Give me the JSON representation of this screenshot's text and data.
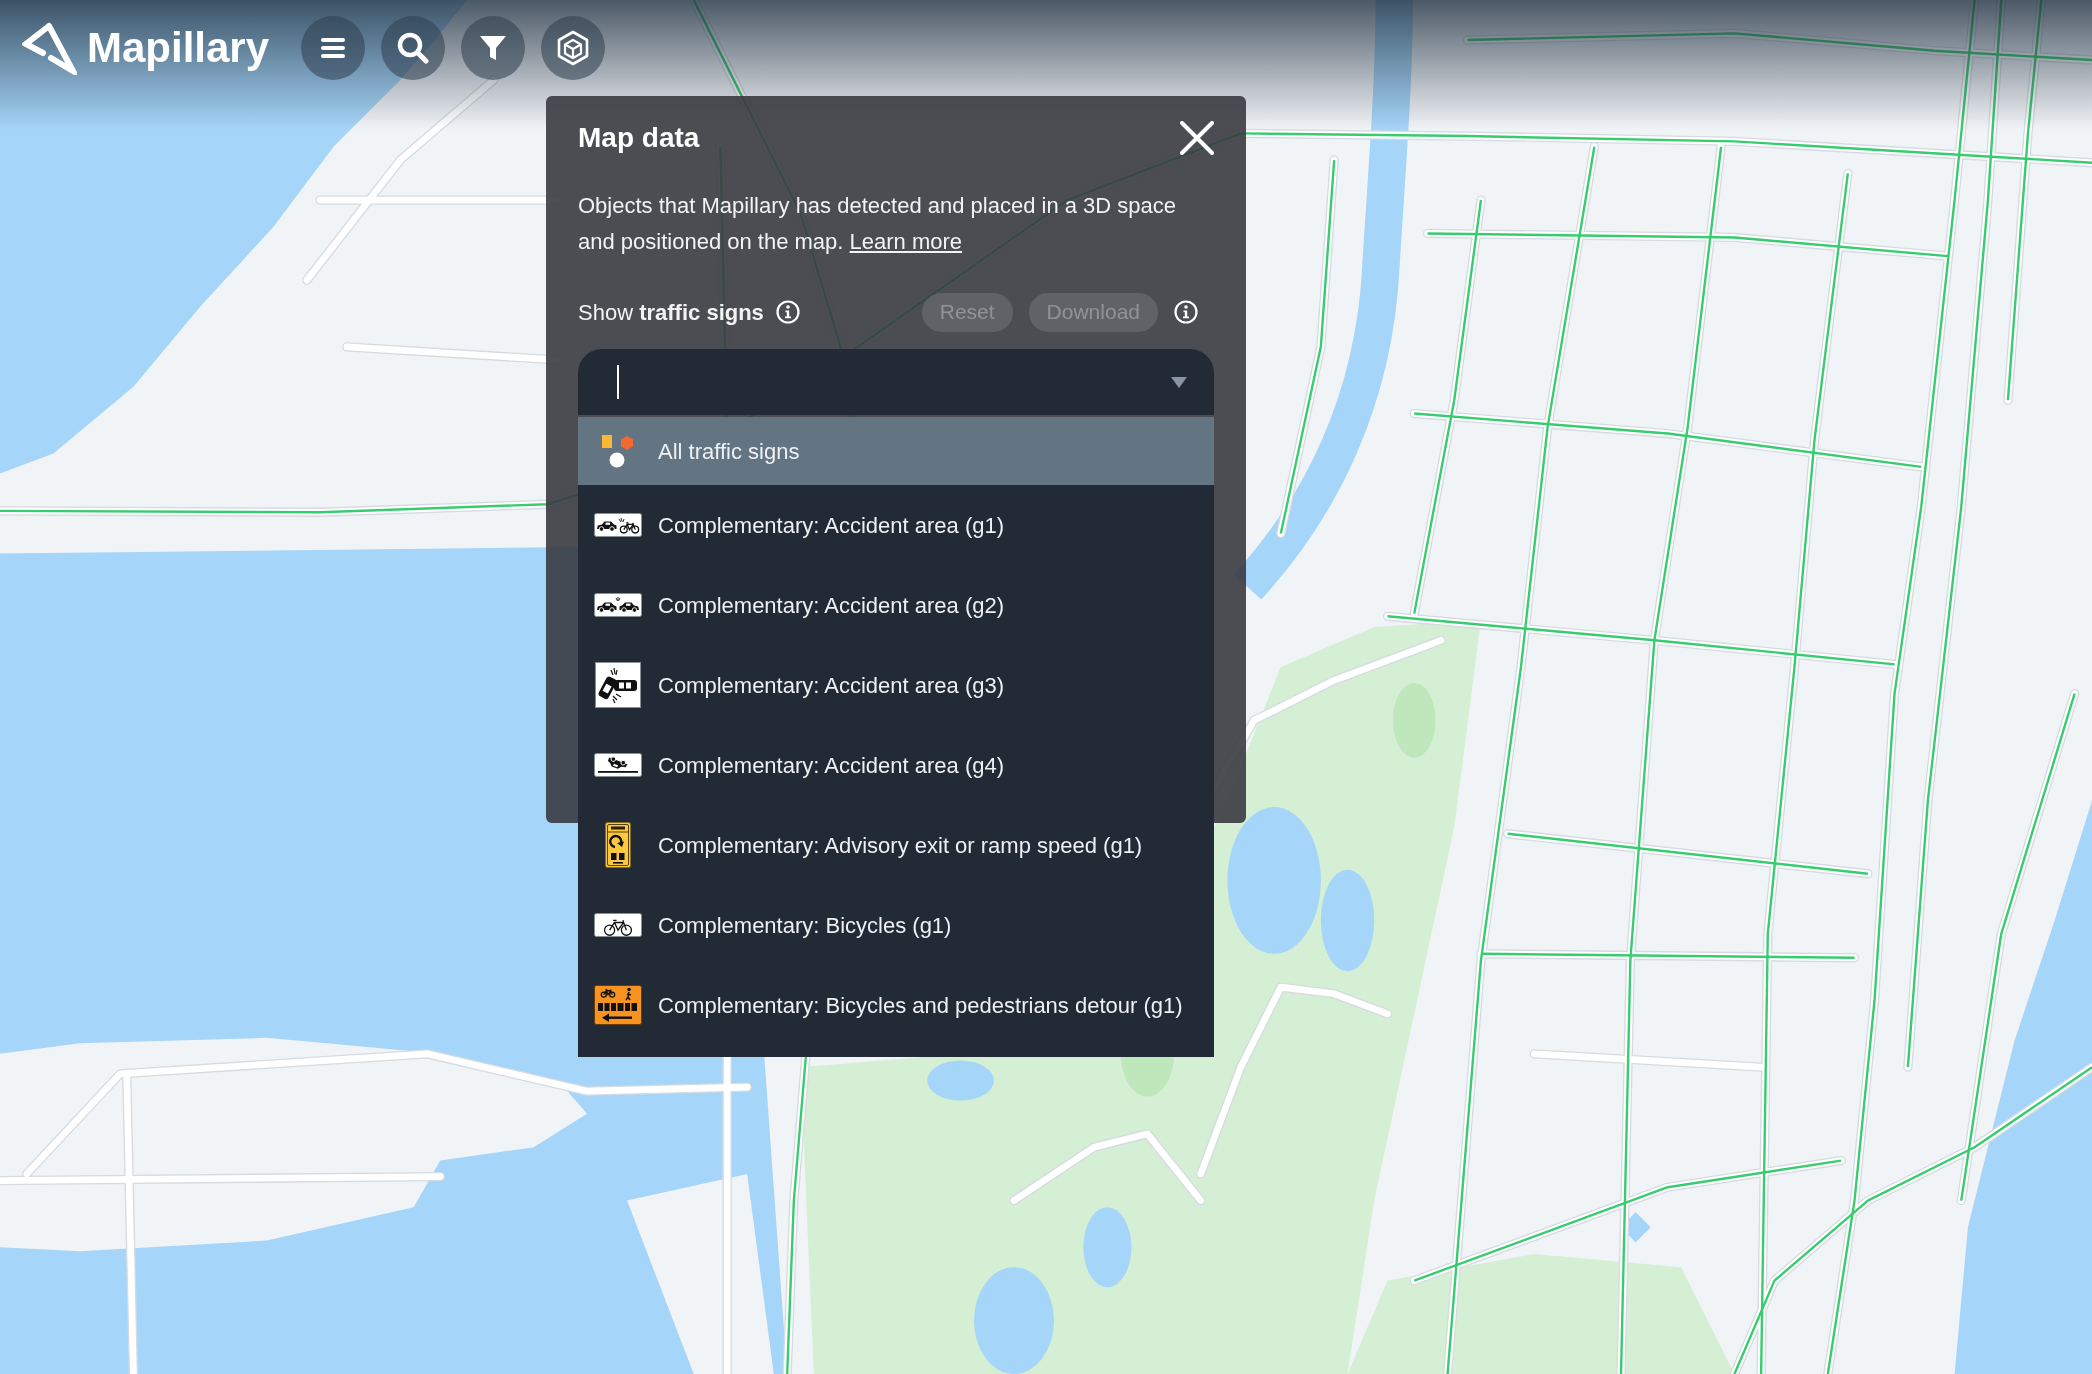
{
  "header": {
    "logo": "Mapillary",
    "buttons": [
      {
        "kind": "menu"
      },
      {
        "kind": "search"
      },
      {
        "kind": "filter"
      },
      {
        "kind": "cube"
      }
    ]
  },
  "panel": {
    "title": "Map data",
    "description": "Objects that Mapillary has detected and placed in a 3D space and positioned on the map.",
    "link": "Learn more",
    "filter_label": "Show **traffic signs**",
    "actions": [
      {
        "label": "Reset",
        "disabled": true
      },
      {
        "label": "Download",
        "disabled": true
      }
    ]
  },
  "dropdown": {
    "focused": true,
    "expanded": true,
    "options": [
      {
        "label": "All traffic signs",
        "kind": "all",
        "selected": true
      },
      {
        "label": "Complementary: Accident area (g1)",
        "kind": "carbike",
        "selected": false
      },
      {
        "label": "Complementary: Accident area (g2)",
        "kind": "carcar",
        "selected": false
      },
      {
        "label": "Complementary: Accident area (g3)",
        "kind": "crash",
        "selected": false
      },
      {
        "label": "Complementary: Accident area (g4)",
        "kind": "rollover",
        "selected": false
      },
      {
        "label": "Complementary: Advisory exit or ramp speed (g1)",
        "kind": "ramp",
        "selected": false
      },
      {
        "label": "Complementary: Bicycles (g1)",
        "kind": "bicycle",
        "selected": false
      },
      {
        "label": "Complementary: Bicycles and pedestrians detour (g1)",
        "kind": "detour",
        "selected": false
      }
    ]
  }
}
